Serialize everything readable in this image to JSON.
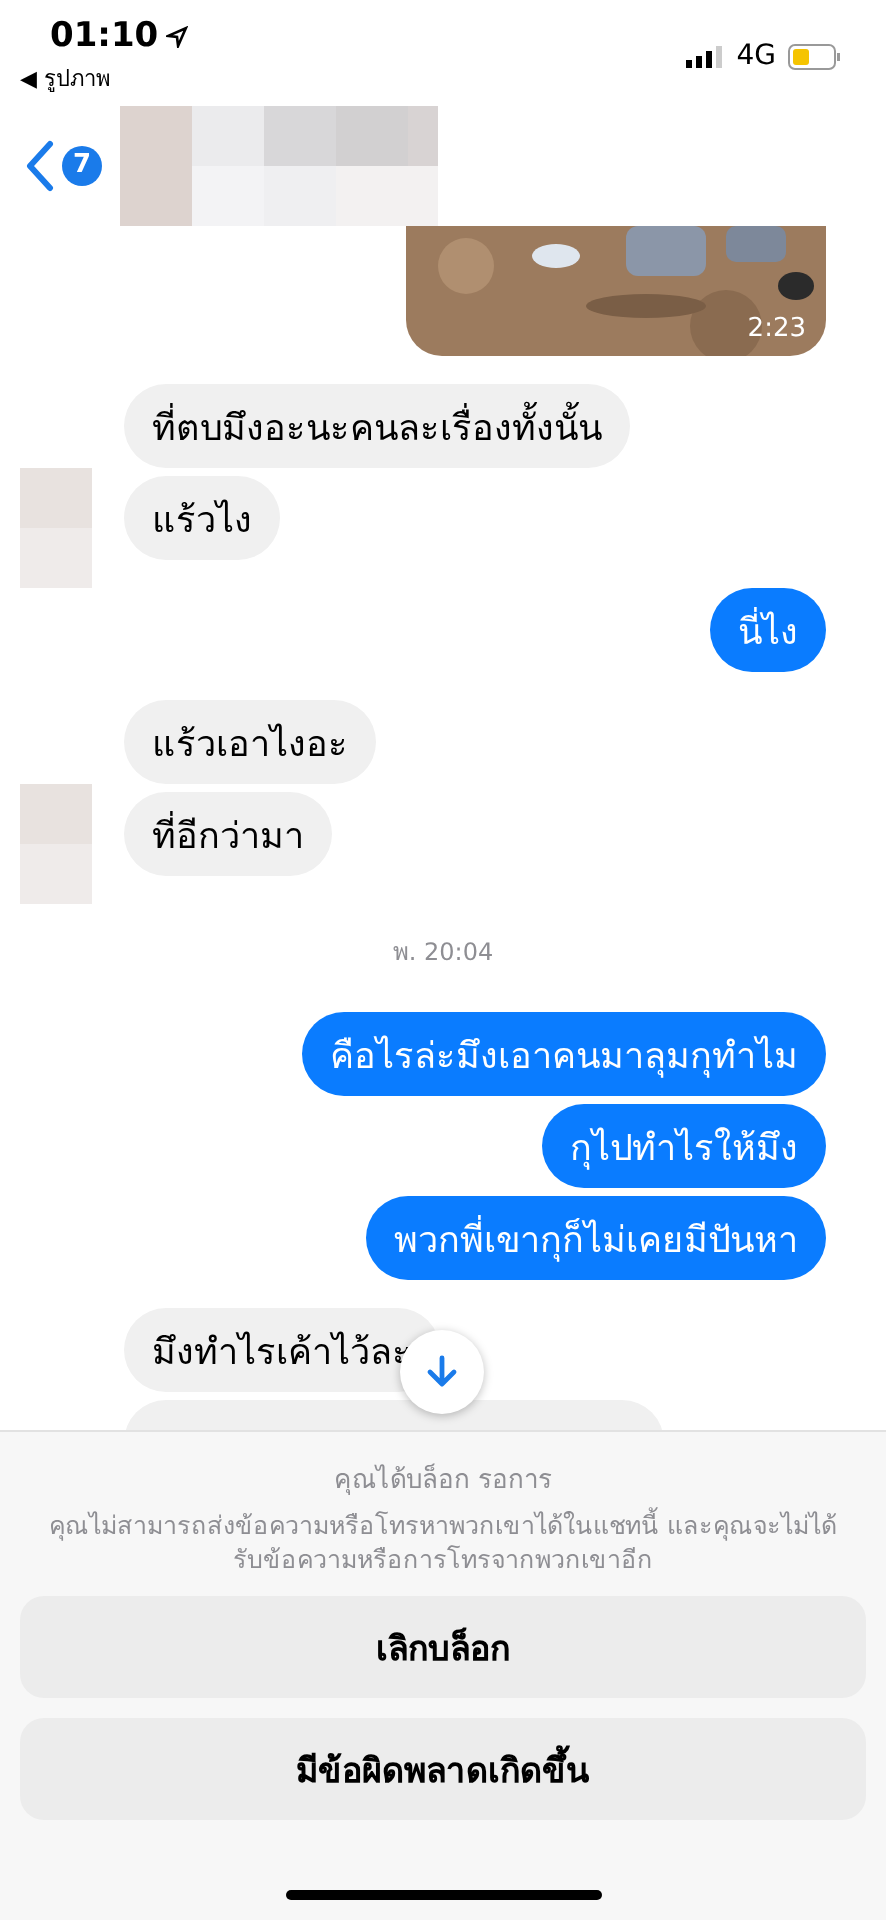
{
  "status_bar": {
    "time": "01:10",
    "back_app": "◀ รูปภาพ",
    "network": "4G"
  },
  "header": {
    "unread_count": "7"
  },
  "messages": [
    {
      "outgoing": true,
      "duration": "2:23"
    },
    {
      "kind": "text",
      "outgoing": false,
      "text": "ที่ตบมึงอะนะคนละเรื่องทั้งนั้น",
      "avatar": false
    },
    {
      "kind": "text",
      "outgoing": false,
      "text": "แร้วไง",
      "avatar": true
    },
    {
      "kind": "text",
      "outgoing": true,
      "text": "นี่ไง"
    },
    {
      "kind": "text",
      "outgoing": false,
      "text": "แร้วเอาไงอะ",
      "avatar": false
    },
    {
      "kind": "text",
      "outgoing": false,
      "text": "ที่อีกว่ามา",
      "avatar": true
    },
    {
      "kind": "timestamp",
      "text": "พ. 20:04"
    },
    {
      "kind": "text",
      "outgoing": true,
      "text": "คือไรล่ะมึงเอาคนมาลุมกุทำไม"
    },
    {
      "kind": "text",
      "outgoing": true,
      "text": "กุไปทำไรให้มึง"
    },
    {
      "kind": "text",
      "outgoing": true,
      "text": "พวกพี่เขากุก็ไม่เคยมีปันหา"
    },
    {
      "kind": "text",
      "outgoing": false,
      "text": "มึงทำไรเค้าไว้ละ"
    },
    {
      "kind": "hidden",
      "outgoing": false
    }
  ],
  "blocked_notice": {
    "title": "คุณได้บล็อก รอการ",
    "description": "คุณไม่สามารถส่งข้อความหรือโทรหาพวกเขาได้ในแชทนี้ และคุณจะไม่ได้รับข้อความหรือการโทรจากพวกเขาอีก"
  },
  "buttons": [
    "เลิกบล็อก",
    "มีข้อผิดพลาดเกิดขึ้น"
  ]
}
